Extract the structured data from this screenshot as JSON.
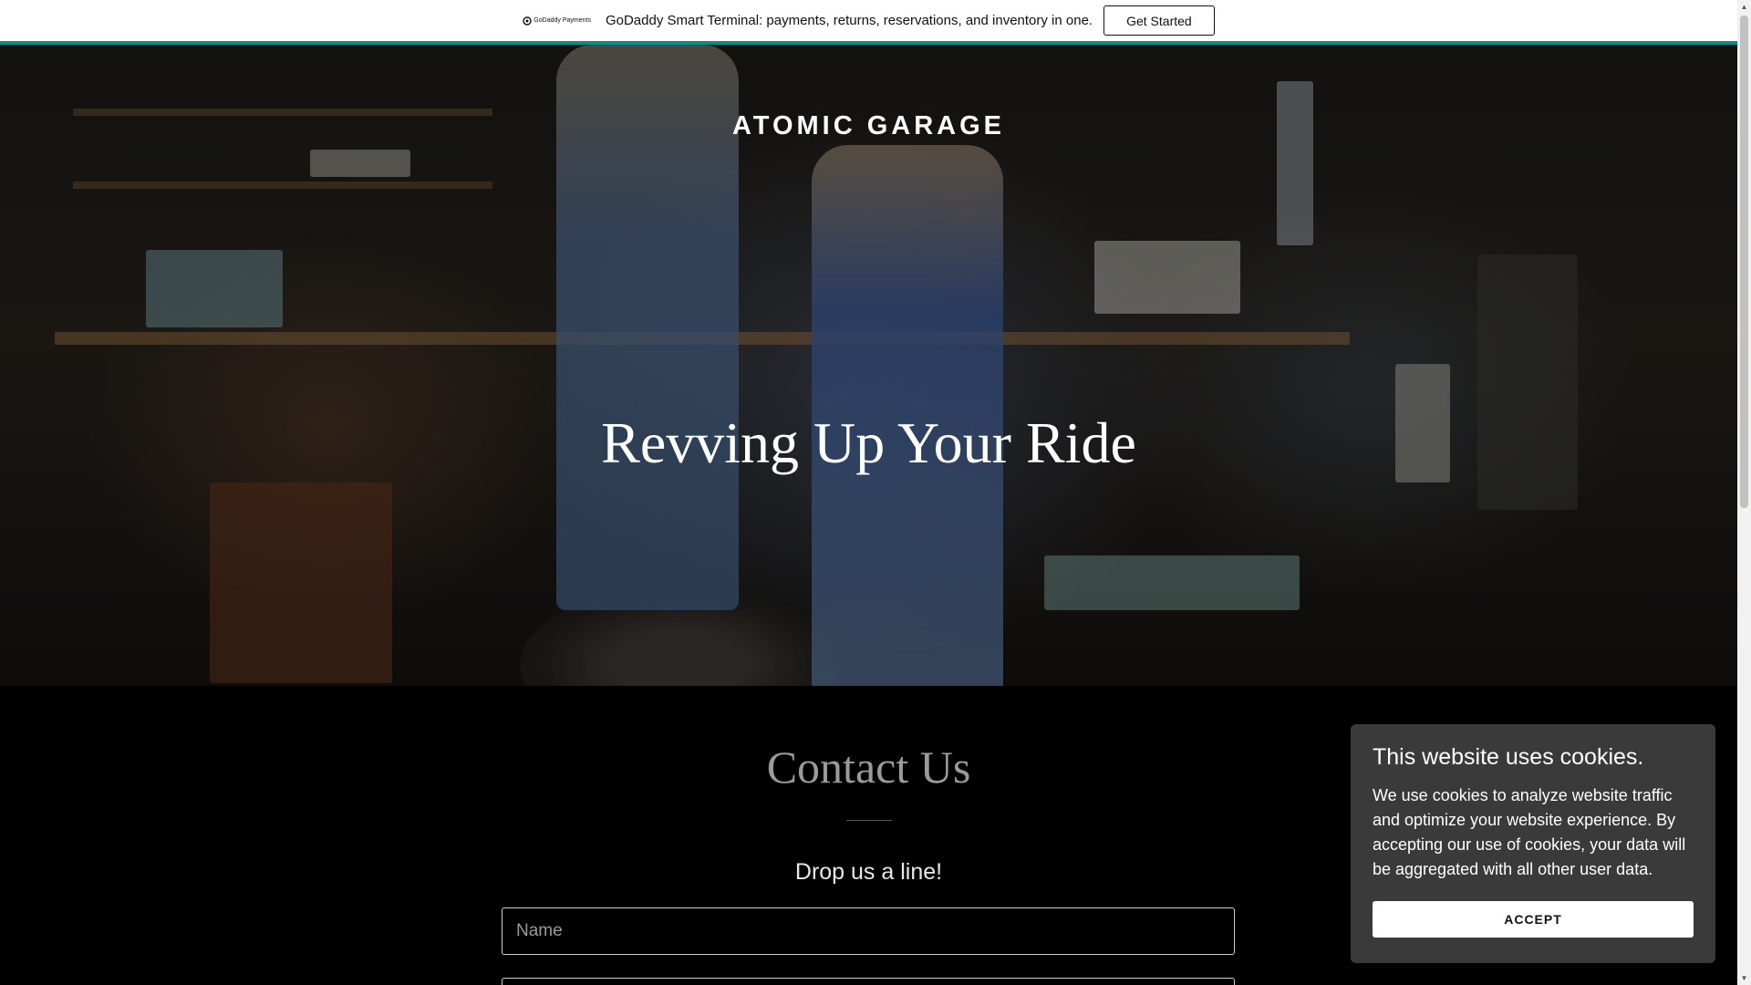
{
  "promo": {
    "logo_text": "GoDaddy Payments",
    "message": "GoDaddy Smart Terminal: payments, returns, reservations, and inventory in one.",
    "cta_label": "Get Started",
    "accent_color": "#0b8c8c"
  },
  "hero": {
    "site_title": "ATOMIC GARAGE",
    "heading": "Revving Up Your Ride"
  },
  "contact": {
    "title": "Contact Us",
    "subtitle": "Drop us a line!",
    "name_placeholder": "Name"
  },
  "cookie": {
    "title": "This website uses cookies.",
    "body": "We use cookies to analyze website traffic and optimize your website experience. By accepting our use of cookies, your data will be aggregated with all other user data.",
    "accept_label": "ACCEPT"
  },
  "icons": {
    "scroll_up": "▲",
    "scroll_down": "▼"
  }
}
